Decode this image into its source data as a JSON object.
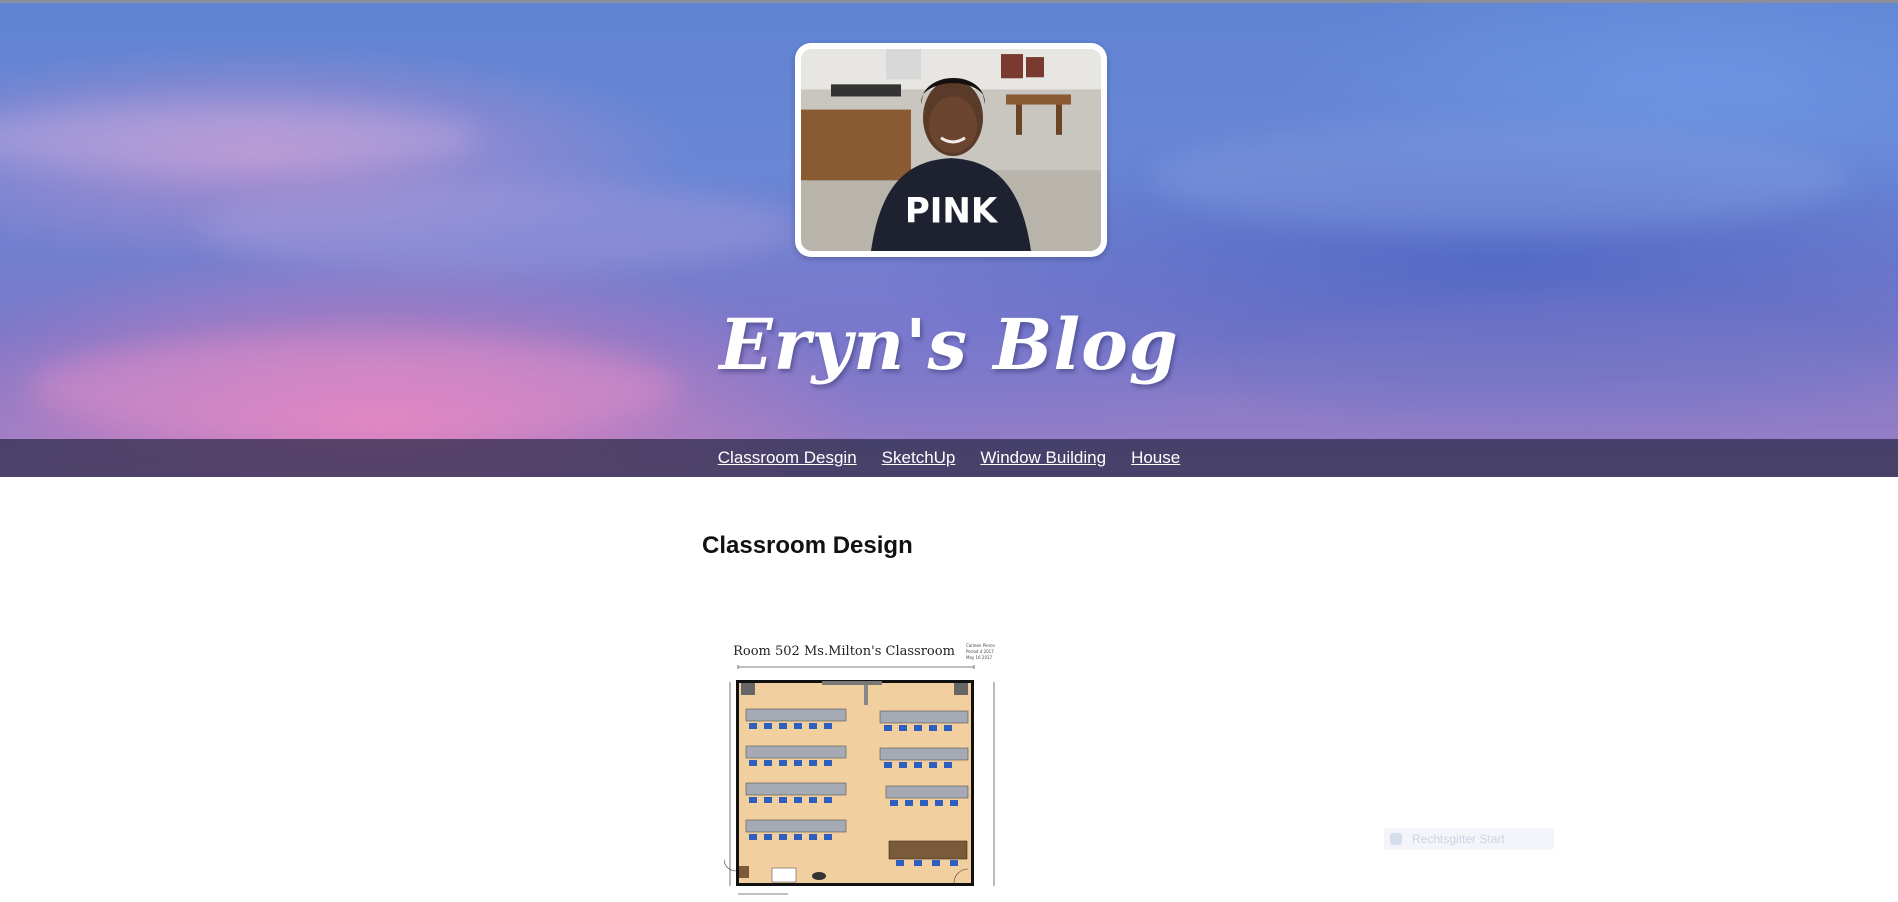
{
  "blog": {
    "title": "Eryn's Blog",
    "photo_alt": "Profile photo of Eryn in classroom"
  },
  "nav": {
    "items": [
      {
        "label": "Classroom Desgin"
      },
      {
        "label": "SketchUp"
      },
      {
        "label": "Window Building"
      },
      {
        "label": "House"
      }
    ]
  },
  "post": {
    "title": "Classroom Design",
    "image": {
      "caption": "Room 502 Ms.Milton's Classroom",
      "corner_note": "Carleen Pierce Period 4 2017 May 16 2017"
    }
  },
  "chat": {
    "label": "Rechtsgitter Start"
  },
  "colors": {
    "nav_bg": "#2a2c46",
    "title_text": "#ffffff",
    "floor": "#f2cf9f",
    "desk": "#a6aab4",
    "chair": "#2e5fbf"
  }
}
